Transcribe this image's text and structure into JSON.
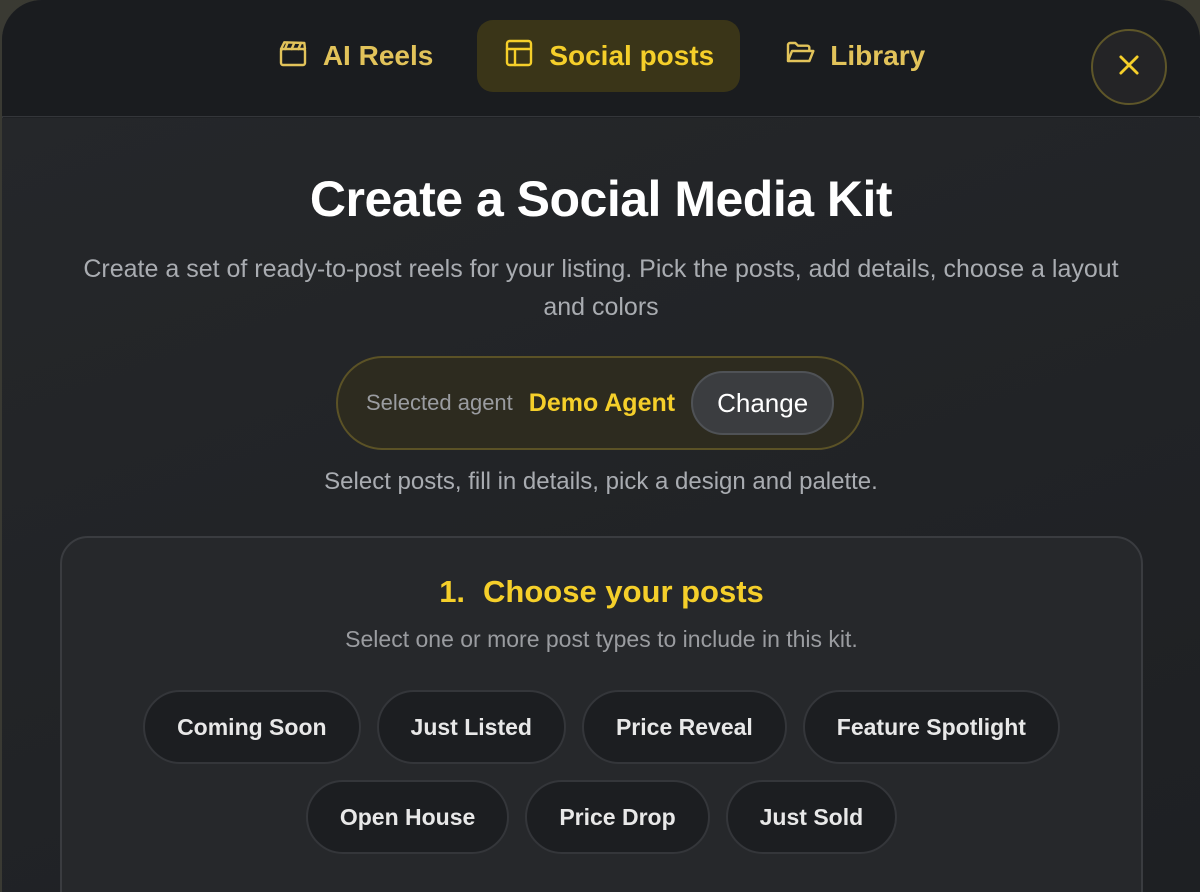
{
  "tabs": [
    {
      "label": "AI Reels",
      "icon": "clapperboard-icon",
      "active": false
    },
    {
      "label": "Social posts",
      "icon": "layout-icon",
      "active": true
    },
    {
      "label": "Library",
      "icon": "folder-open-icon",
      "active": false
    }
  ],
  "close_icon": "close-icon",
  "header": {
    "title": "Create a Social Media Kit",
    "subtitle": "Create a set of ready-to-post reels for your listing. Pick the posts, add details, choose a layout and colors"
  },
  "agent": {
    "label": "Selected agent",
    "name": "Demo Agent",
    "change_label": "Change"
  },
  "helper": "Select posts, fill in details, pick a design and palette.",
  "section": {
    "number": "1.",
    "title": "Choose your posts",
    "description": "Select one or more post types to include in this kit.",
    "chips_row1": [
      "Coming Soon",
      "Just Listed",
      "Price Reveal",
      "Feature Spotlight"
    ],
    "chips_row2": [
      "Open House",
      "Price Drop",
      "Just Sold"
    ]
  },
  "colors": {
    "accent": "#f5cf2a",
    "background": "#1f2124",
    "active_tab_bg": "#3a3518"
  }
}
